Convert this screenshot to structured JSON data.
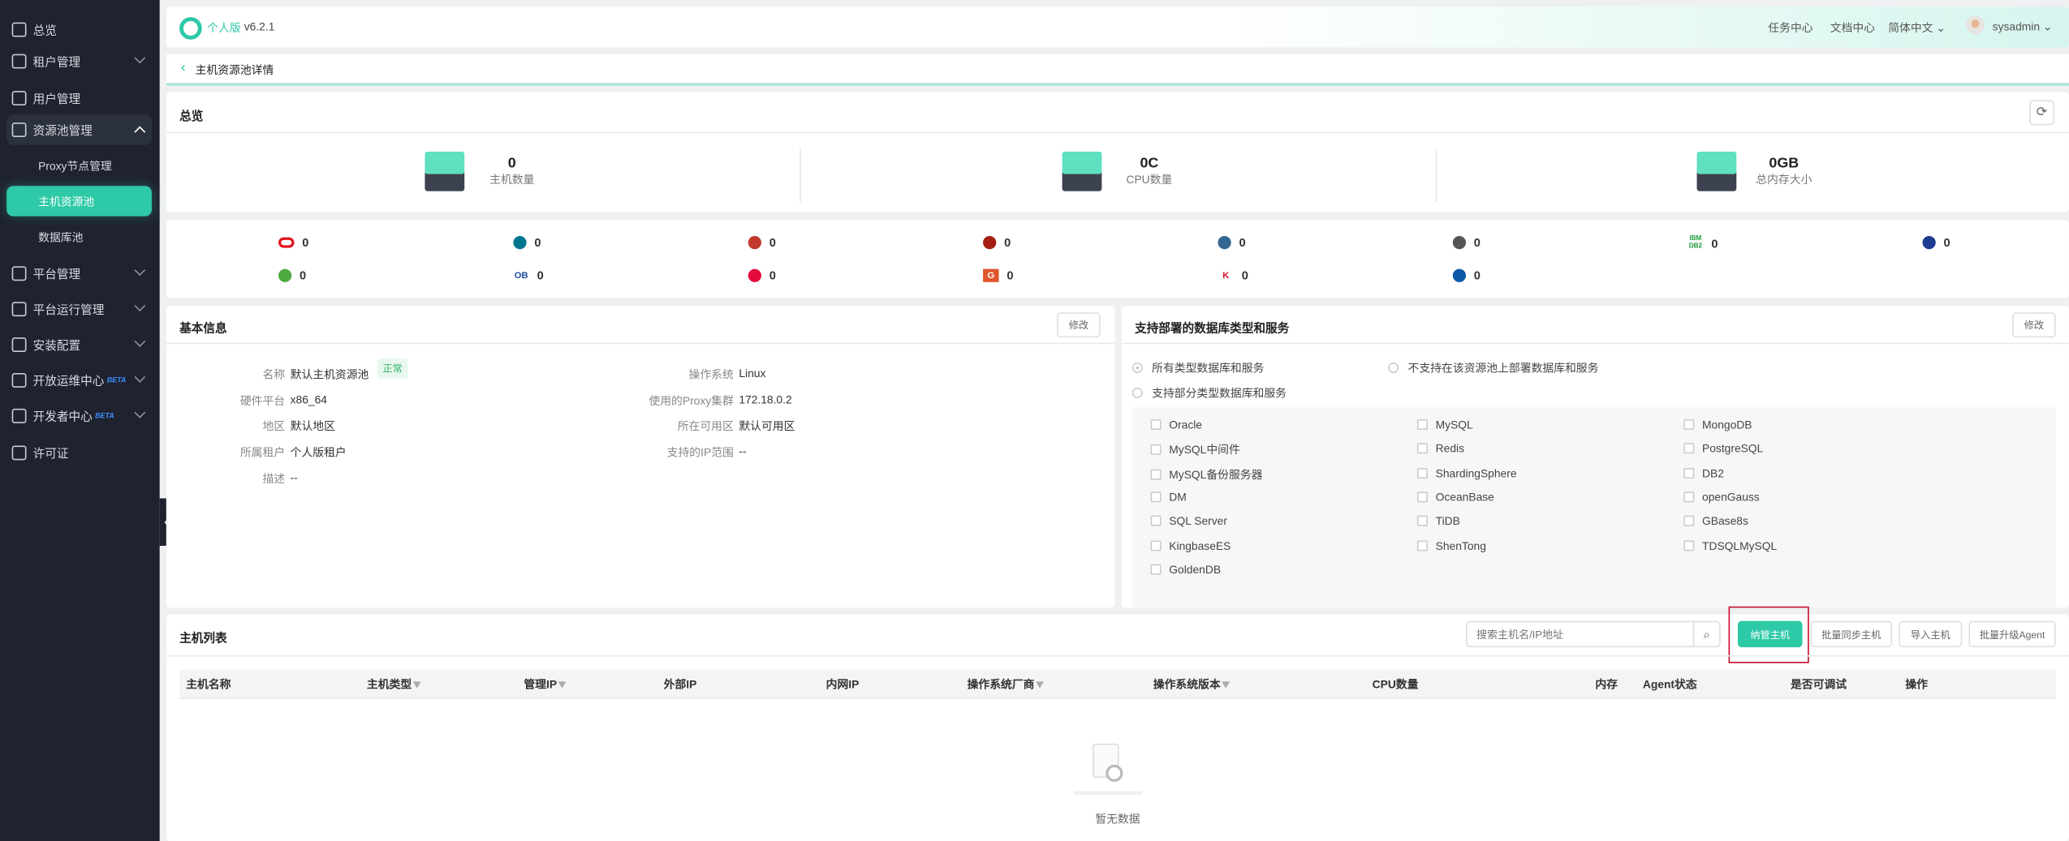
{
  "sidebar": {
    "items": [
      {
        "label": "总览",
        "icon": "dashboard-icon"
      },
      {
        "label": "租户管理",
        "icon": "building-icon"
      },
      {
        "label": "用户管理",
        "icon": "users-icon"
      },
      {
        "label": "资源池管理",
        "icon": "resource-pool-icon"
      },
      {
        "label": "平台管理",
        "icon": "platform-icon"
      },
      {
        "label": "平台运行管理",
        "icon": "ops-icon"
      },
      {
        "label": "安装配置",
        "icon": "install-icon"
      },
      {
        "label": "开放运维中心",
        "icon": "infinity-icon",
        "badge": "BETA"
      },
      {
        "label": "开发者中心",
        "icon": "infinity-icon",
        "badge": "BETA"
      },
      {
        "label": "许可证",
        "icon": "license-icon"
      }
    ],
    "subitems": [
      "Proxy节点管理",
      "主机资源池",
      "数据库池"
    ],
    "active": "主机资源池"
  },
  "header": {
    "edition": "个人版",
    "version": "v6.2.1",
    "links": [
      "任务中心",
      "文档中心"
    ],
    "language": "简体中文",
    "user": "sysadmin"
  },
  "breadcrumb": {
    "title": "主机资源池详情"
  },
  "overview": {
    "title": "总览",
    "stats": [
      {
        "value": "0",
        "label": "主机数量"
      },
      {
        "value": "0C",
        "label": "CPU数量"
      },
      {
        "value": "0GB",
        "label": "总内存大小"
      }
    ]
  },
  "db_counts": [
    {
      "db": "Oracle",
      "count": "0",
      "color": "#e0141e"
    },
    {
      "db": "MySQL",
      "count": "0",
      "color": "#00758f"
    },
    {
      "db": "MySQL中间件",
      "count": "0",
      "color": "#c0392b"
    },
    {
      "db": "Redis",
      "count": "0",
      "color": "#a41e11"
    },
    {
      "db": "PostgreSQL",
      "count": "0",
      "color": "#336791"
    },
    {
      "db": "ShardingSphere",
      "count": "0",
      "color": "#555555"
    },
    {
      "db": "DB2",
      "count": "0",
      "color": "#1a9b3a",
      "text": "IBM DB2"
    },
    {
      "db": "SQL Server",
      "count": "0",
      "color": "#1d3b8f"
    },
    {
      "db": "MongoDB",
      "count": "0",
      "color": "#4faa41"
    },
    {
      "db": "OceanBase",
      "count": "0",
      "color": "#1c4e9a",
      "text": "OB"
    },
    {
      "db": "TiDB",
      "count": "0",
      "color": "#e30c3e"
    },
    {
      "db": "GBase",
      "count": "0",
      "color": "#e0562e",
      "text": "G"
    },
    {
      "db": "KingbaseES",
      "count": "0",
      "color": "#d0102c",
      "text": "K"
    },
    {
      "db": "ShenTong",
      "count": "0",
      "color": "#0a58a8"
    }
  ],
  "basic_info": {
    "title": "基本信息",
    "edit": "修改",
    "status": "正常",
    "fields": [
      {
        "label": "名称",
        "value": "默认主机资源池"
      },
      {
        "label": "硬件平台",
        "value": "x86_64"
      },
      {
        "label": "地区",
        "value": "默认地区"
      },
      {
        "label": "所属租户",
        "value": "个人版租户"
      },
      {
        "label": "描述",
        "value": "--"
      },
      {
        "label": "操作系统",
        "value": "Linux"
      },
      {
        "label": "使用的Proxy集群",
        "value": "172.18.0.2"
      },
      {
        "label": "所在可用区",
        "value": "默认可用区"
      },
      {
        "label": "支持的IP范围",
        "value": "--"
      }
    ]
  },
  "supported": {
    "title": "支持部署的数据库类型和服务",
    "edit": "修改",
    "radios": [
      {
        "label": "所有类型数据库和服务",
        "selected": true
      },
      {
        "label": "不支持在该资源池上部署数据库和服务",
        "selected": false
      },
      {
        "label": "支持部分类型数据库和服务",
        "selected": false
      }
    ],
    "checkboxes": [
      "Oracle",
      "MySQL",
      "MongoDB",
      "MySQL中间件",
      "Redis",
      "PostgreSQL",
      "MySQL备份服务器",
      "ShardingSphere",
      "DB2",
      "DM",
      "OceanBase",
      "openGauss",
      "SQL Server",
      "TiDB",
      "GBase8s",
      "KingbaseES",
      "ShenTong",
      "TDSQLMySQL",
      "GoldenDB"
    ]
  },
  "host_list": {
    "title": "主机列表",
    "search_placeholder": "搜索主机名/IP地址",
    "buttons": [
      "纳管主机",
      "批量同步主机",
      "导入主机",
      "批量升级Agent"
    ],
    "columns": [
      {
        "label": "主机名称"
      },
      {
        "label": "主机类型",
        "filter": true
      },
      {
        "label": "管理IP",
        "filter": true
      },
      {
        "label": "外部IP"
      },
      {
        "label": "内网IP"
      },
      {
        "label": "操作系统厂商",
        "filter": true
      },
      {
        "label": "操作系统版本",
        "filter": true
      },
      {
        "label": "CPU数量"
      },
      {
        "label": "内存"
      },
      {
        "label": "Agent状态"
      },
      {
        "label": "是否可调试"
      },
      {
        "label": "操作"
      }
    ],
    "empty": "暂无数据"
  },
  "colors": {
    "accent": "#2ec9a7",
    "sidebar": "#1f2330",
    "highlight_border": "#c8102e"
  }
}
